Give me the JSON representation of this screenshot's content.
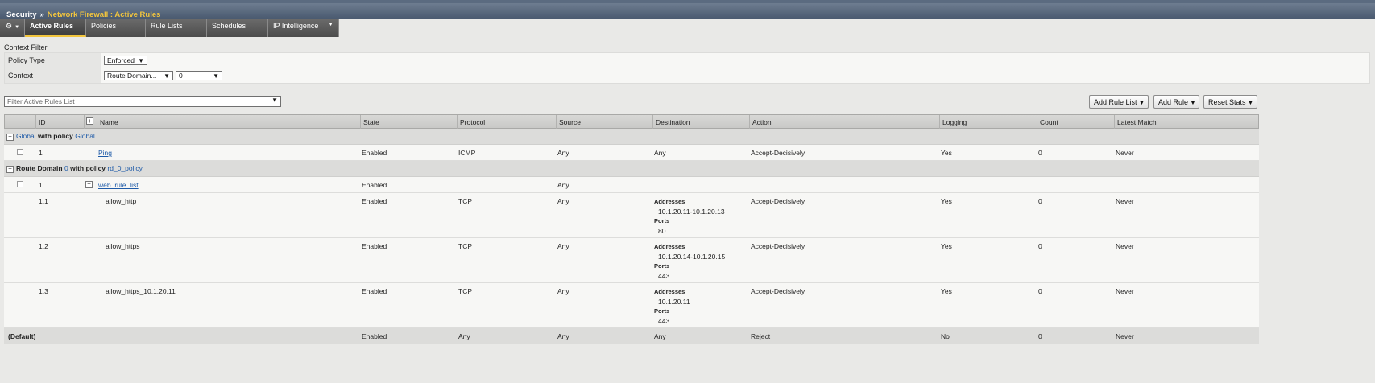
{
  "breadcrumb": {
    "root": "Security",
    "separator": "»",
    "current": "Network Firewall : Active Rules"
  },
  "tabs": [
    {
      "label": "Active Rules",
      "active": true
    },
    {
      "label": "Policies"
    },
    {
      "label": "Rule Lists"
    },
    {
      "label": "Schedules"
    },
    {
      "label": "IP Intelligence"
    }
  ],
  "context_filter": {
    "title": "Context Filter",
    "policy_type_label": "Policy Type",
    "policy_type_value": "Enforced",
    "context_label": "Context",
    "context_value": "Route Domain...",
    "context_id_value": "0"
  },
  "filter": {
    "placeholder": "Filter Active Rules List"
  },
  "buttons": {
    "add_rule_list": "Add Rule List",
    "add_rule": "Add Rule",
    "reset_stats": "Reset Stats"
  },
  "table": {
    "headers": {
      "id": "ID",
      "name": "Name",
      "state": "State",
      "protocol": "Protocol",
      "source": "Source",
      "destination": "Destination",
      "action": "Action",
      "logging": "Logging",
      "count": "Count",
      "latest_match": "Latest Match"
    },
    "group1": {
      "prefix": "Global",
      "mid": "with policy",
      "policy": "Global"
    },
    "rule1": {
      "id": "1",
      "name": "Ping",
      "state": "Enabled",
      "protocol": "ICMP",
      "source": "Any",
      "destination": "Any",
      "action": "Accept-Decisively",
      "logging": "Yes",
      "count": "0",
      "latest_match": "Never"
    },
    "group2": {
      "prefix": "Route Domain",
      "domain": "0",
      "mid": "with policy",
      "policy": "rd_0_policy"
    },
    "rulelist": {
      "id": "1",
      "name": "web_rule_list",
      "state": "Enabled",
      "source": "Any"
    },
    "sub_rules": [
      {
        "id": "1.1",
        "name": "allow_http",
        "state": "Enabled",
        "protocol": "TCP",
        "source": "Any",
        "addresses_label": "Addresses",
        "addresses": "10.1.20.11-10.1.20.13",
        "ports_label": "Ports",
        "ports": "80",
        "action": "Accept-Decisively",
        "logging": "Yes",
        "count": "0",
        "latest_match": "Never"
      },
      {
        "id": "1.2",
        "name": "allow_https",
        "state": "Enabled",
        "protocol": "TCP",
        "source": "Any",
        "addresses_label": "Addresses",
        "addresses": "10.1.20.14-10.1.20.15",
        "ports_label": "Ports",
        "ports": "443",
        "action": "Accept-Decisively",
        "logging": "Yes",
        "count": "0",
        "latest_match": "Never"
      },
      {
        "id": "1.3",
        "name": "allow_https_10.1.20.11",
        "state": "Enabled",
        "protocol": "TCP",
        "source": "Any",
        "addresses_label": "Addresses",
        "addresses": "10.1.20.11",
        "ports_label": "Ports",
        "ports": "443",
        "action": "Accept-Decisively",
        "logging": "Yes",
        "count": "0",
        "latest_match": "Never"
      }
    ],
    "default_row": {
      "name": "(Default)",
      "state": "Enabled",
      "protocol": "Any",
      "source": "Any",
      "destination": "Any",
      "action": "Reject",
      "logging": "No",
      "count": "0",
      "latest_match": "Never"
    }
  }
}
